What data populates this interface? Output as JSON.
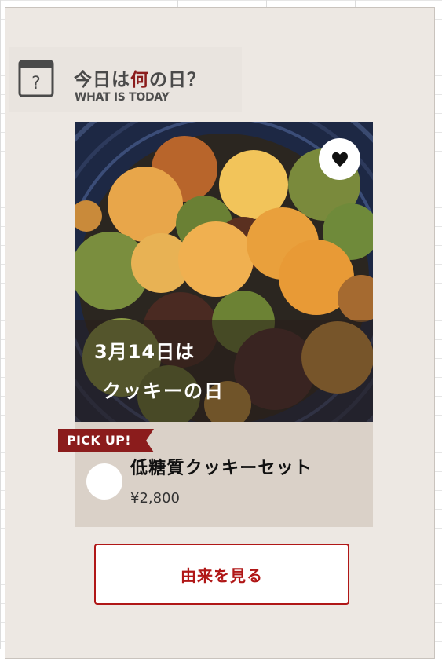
{
  "header": {
    "title_prefix": "今日は",
    "title_accent": "何",
    "title_suffix": "の日？",
    "subtitle": "WHAT IS TODAY",
    "icon": "calendar-question-icon"
  },
  "feature": {
    "image": "cookie-assortment-photo",
    "date_line": "3月14日は",
    "day_line": "クッキーの日",
    "favorite_icon": "heart-icon"
  },
  "pickup": {
    "badge": "PICK UP!",
    "product_name": "低糖質クッキーセット",
    "price": "¥2,800"
  },
  "cta": {
    "label": "由来を見る"
  },
  "colors": {
    "accent": "#8b1c1c",
    "button_red": "#b01717",
    "card_bg": "#ede8e3",
    "product_bg": "#dad1c8"
  }
}
